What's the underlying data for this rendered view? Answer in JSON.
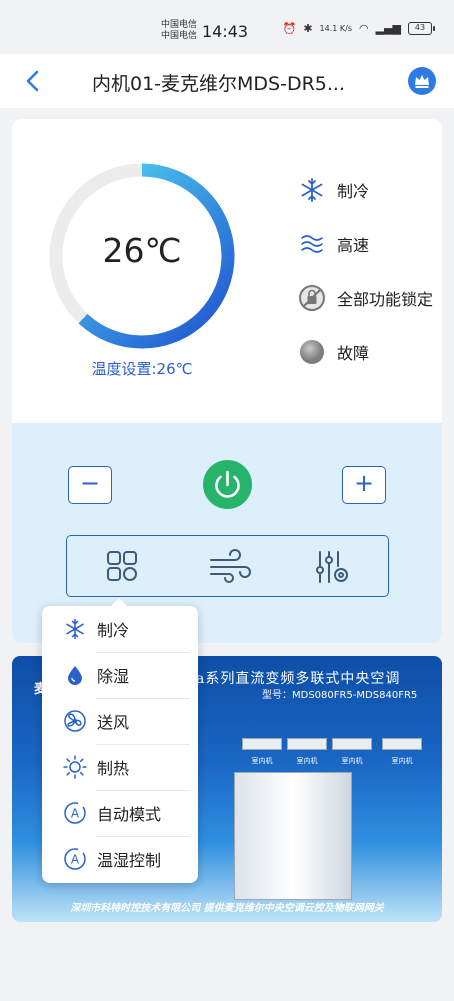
{
  "status_bar": {
    "carrier_1": "中国电信",
    "carrier_2": "中国电信",
    "time": "14:43",
    "speed": "14.1 K/s",
    "battery": "43"
  },
  "header": {
    "title": "内机01-麦克维尔MDS-DR5..."
  },
  "thermostat": {
    "temperature": "26℃",
    "setpoint": "温度设置:26℃",
    "dial_level": 0.62
  },
  "status": {
    "mode_label": "制冷",
    "fan_label": "高速",
    "lock_label": "全部功能锁定",
    "fault_label": "故障"
  },
  "controls": {
    "minus_label": "−",
    "plus_label": "+"
  },
  "mode_menu": {
    "items": [
      {
        "label": "制冷",
        "icon": "snowflake-icon"
      },
      {
        "label": "除湿",
        "icon": "water-drop-icon"
      },
      {
        "label": "送风",
        "icon": "fan-icon"
      },
      {
        "label": "制热",
        "icon": "sun-icon"
      },
      {
        "label": "自动模式",
        "icon": "auto-icon"
      },
      {
        "label": "温湿控制",
        "icon": "auto-icon"
      }
    ]
  },
  "banner": {
    "title": "na系列直流变频多联式中央空调",
    "model": "型号：MDS080FR5-MDS840FR5",
    "indoor_label": "室内机",
    "footer": "深圳市科特时控技术有限公司    提供麦克维尔中央空调云控及物联网网关"
  },
  "colors": {
    "accent": "#2a62c9",
    "power": "#26b36a",
    "panel": "#dceffa"
  }
}
